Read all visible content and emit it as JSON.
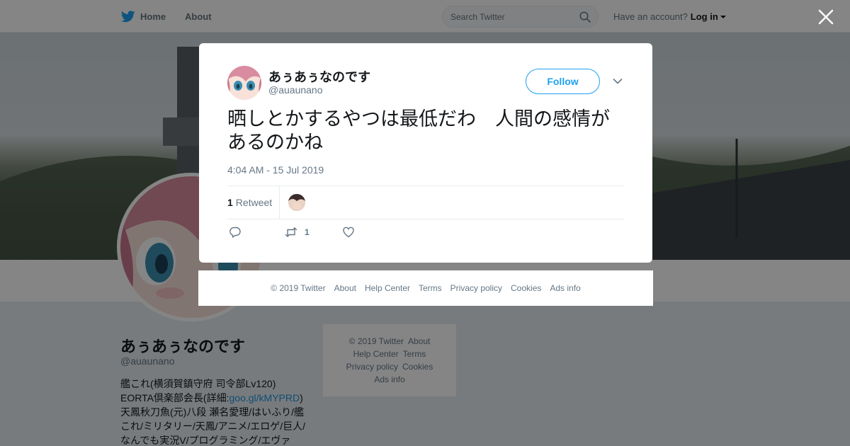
{
  "colors": {
    "accent": "#1da1f2",
    "link": "#1b95e0",
    "text": "#14171a",
    "muted": "#657786",
    "background": "#e6ecf0"
  },
  "topbar": {
    "home_label": "Home",
    "about_label": "About",
    "search_placeholder": "Search Twitter",
    "have_account": "Have an account?",
    "login_label": "Log in"
  },
  "profile": {
    "name": "あぅあぅなのです",
    "handle": "@auaunano",
    "bio_line1": "艦これ(横須賀鎮守府 司令部Lv120)",
    "bio_line2_prefix": "EORTA倶楽部会長(詳細:",
    "bio_link": "goo.gl/kMYPRD",
    "bio_line2_suffix": ")",
    "bio_line3": "天鳳秋刀魚(元)八段 瀬名愛理/はいふり/艦これ/ミリタリー/天鳳/アニメ/エロゲ/巨人/なんでも実況V/プログラミング/エヴァ"
  },
  "side_footer": {
    "copyright": "© 2019 Twitter",
    "about": "About",
    "help": "Help Center",
    "terms": "Terms",
    "privacy": "Privacy policy",
    "cookies": "Cookies",
    "ads": "Ads info"
  },
  "modal": {
    "name": "あぅあぅなのです",
    "handle": "@auaunano",
    "follow_label": "Follow",
    "tweet_text": "晒しとかするやつは最低だわ　人間の感情があるのかね",
    "timestamp": "4:04 AM - 15 Jul 2019",
    "retweet_count": "1",
    "retweet_label": "Retweet",
    "action_retweet_count": "1"
  },
  "modal_footer": {
    "copyright": "© 2019 Twitter",
    "about": "About",
    "help": "Help Center",
    "terms": "Terms",
    "privacy": "Privacy policy",
    "cookies": "Cookies",
    "ads": "Ads info"
  },
  "icons": [
    "twitter-bird-icon",
    "search-icon",
    "caret-down-icon",
    "close-icon",
    "chevron-down-icon",
    "reply-icon",
    "retweet-icon",
    "like-icon"
  ]
}
